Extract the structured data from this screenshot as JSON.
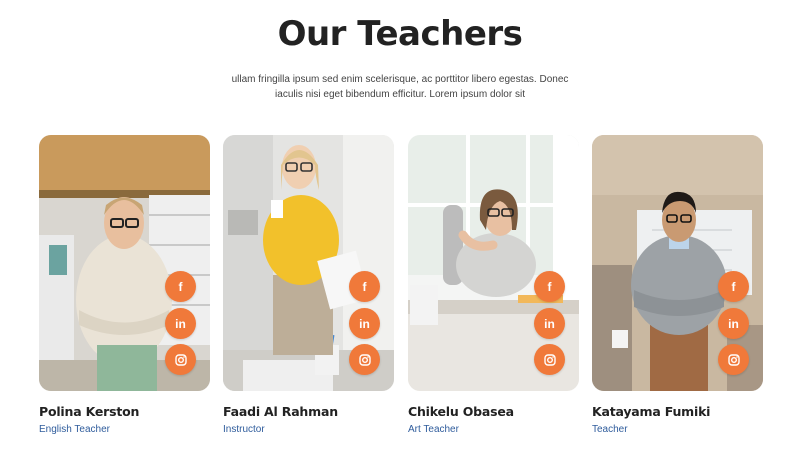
{
  "section": {
    "title": "Our Teachers",
    "subtitle": "ullam fringilla ipsum sed enim scelerisque, ac porttitor libero egestas. Donec iaculis nisi eget bibendum efficitur. Lorem ipsum dolor sit"
  },
  "teachers": [
    {
      "name": "Polina Kerston",
      "role": "English Teacher"
    },
    {
      "name": "Faadi Al Rahman",
      "role": "Instructor"
    },
    {
      "name": "Chikelu Obasea",
      "role": "Art Teacher"
    },
    {
      "name": "Katayama Fumiki",
      "role": "Teacher"
    }
  ],
  "social_icons": [
    "facebook-icon",
    "linkedin-icon",
    "instagram-icon"
  ],
  "colors": {
    "accent": "#f0793a",
    "role_text": "#2f5c9c",
    "title": "#222222"
  }
}
